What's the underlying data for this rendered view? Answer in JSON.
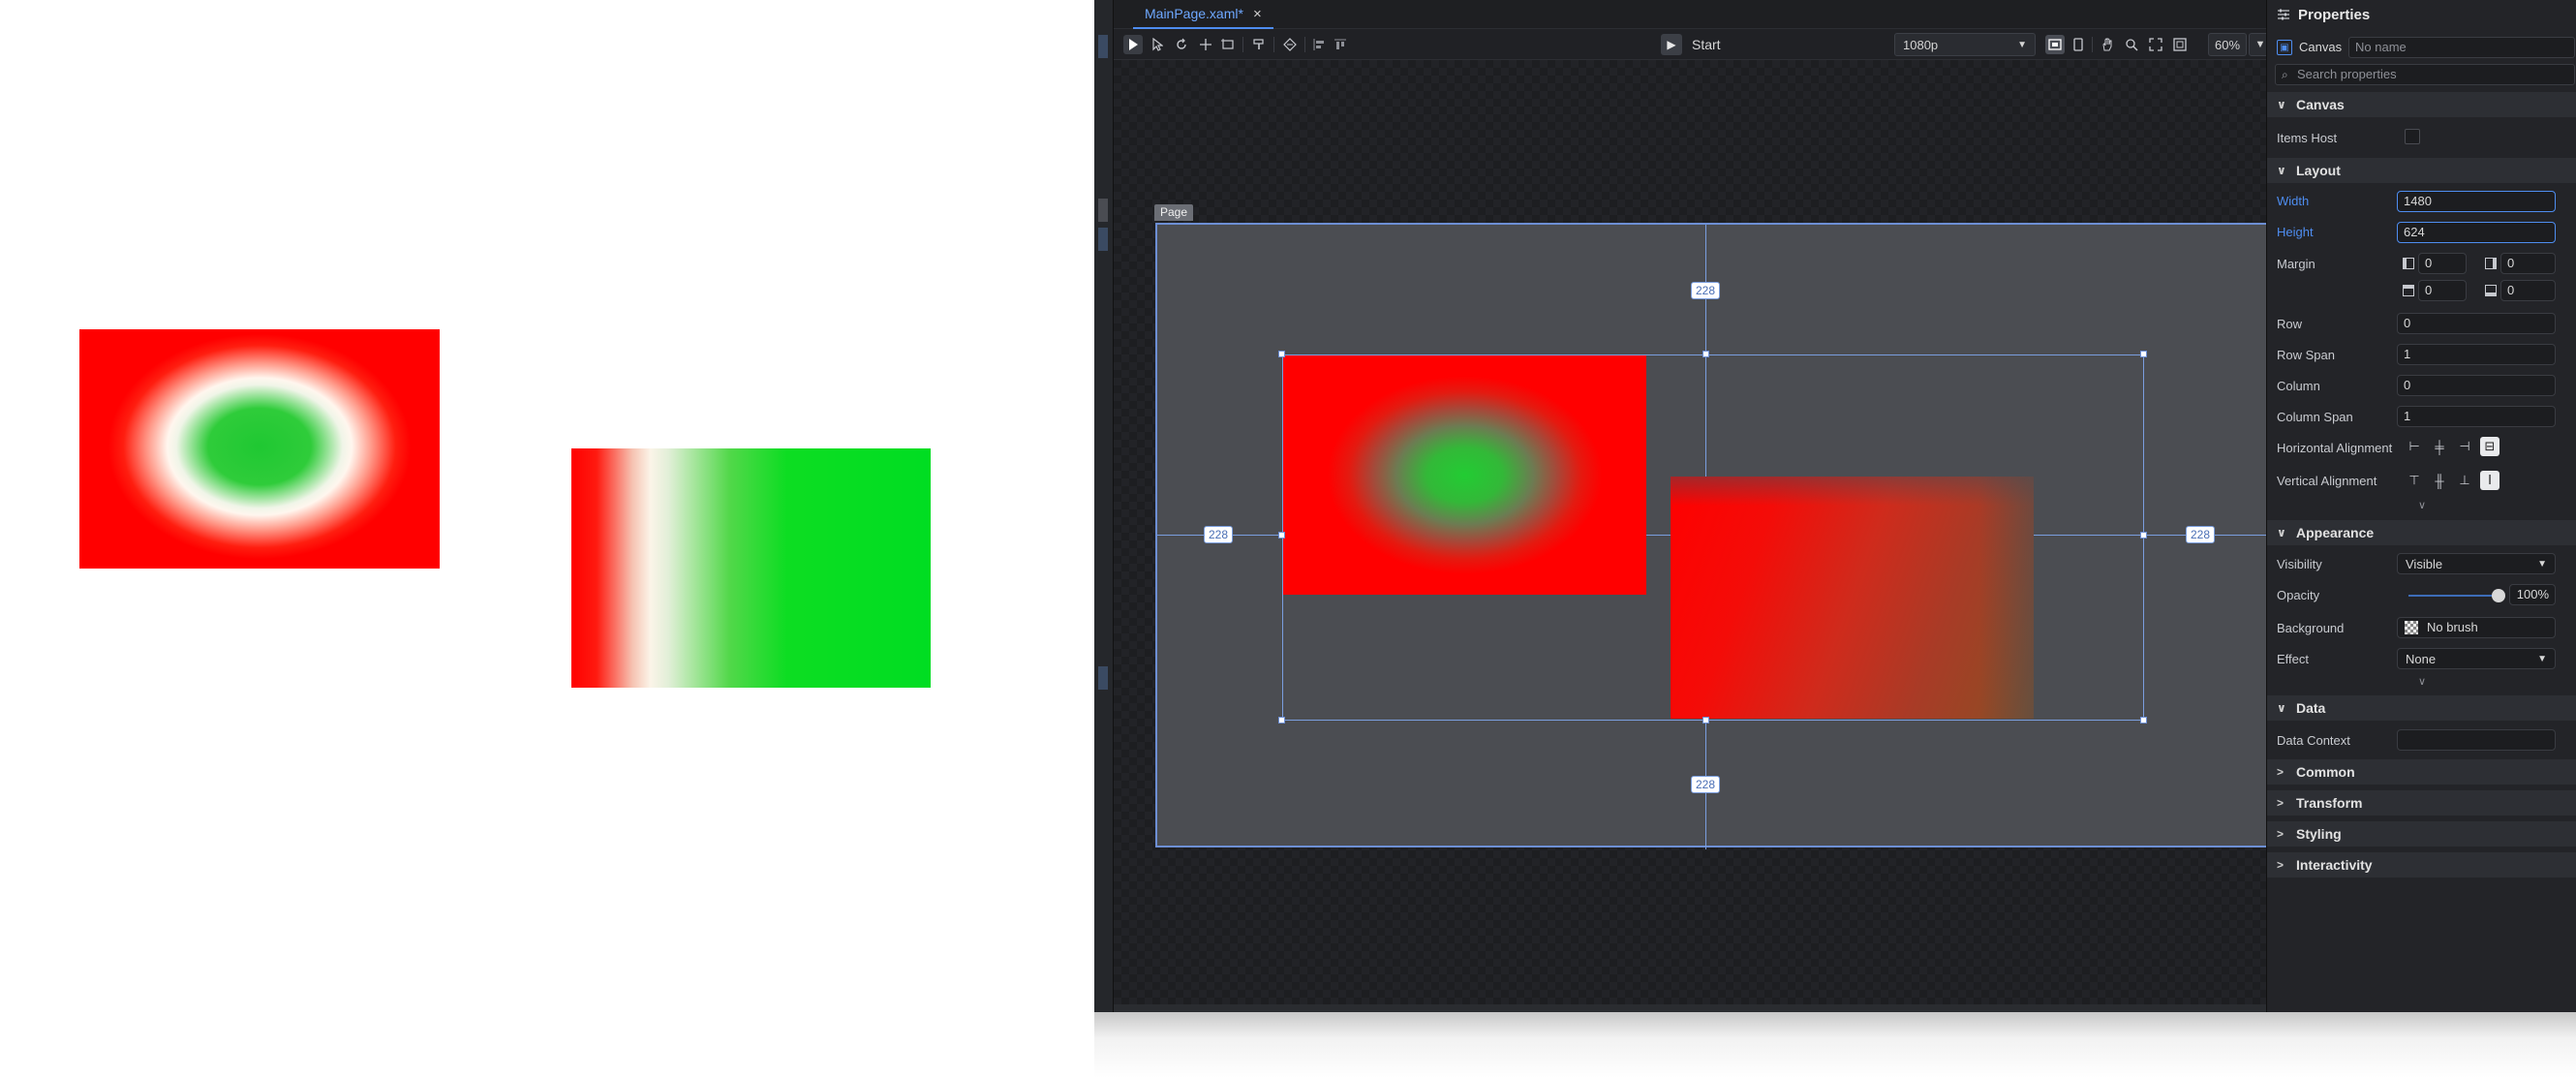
{
  "designer": {
    "tab": {
      "title": "MainPage.xaml*",
      "close_icon": "×"
    },
    "toolbar": {
      "start_label": "Start",
      "resolution": "1080p",
      "zoom": "60%"
    },
    "canvas": {
      "page_label": "Page",
      "guide_top": "228",
      "guide_bottom": "228",
      "guide_left": "228",
      "guide_right": "228"
    }
  },
  "properties": {
    "title": "Properties",
    "element_type": "Canvas",
    "name_placeholder": "No name",
    "search_placeholder": "Search properties",
    "sections": {
      "canvas": "Canvas",
      "layout": "Layout",
      "appearance": "Appearance",
      "data": "Data",
      "common": "Common",
      "transform": "Transform",
      "styling": "Styling",
      "interactivity": "Interactivity"
    },
    "canvas_props": {
      "items_host_label": "Items Host"
    },
    "layout": {
      "width_label": "Width",
      "width_value": "1480",
      "height_label": "Height",
      "height_value": "624",
      "margin_label": "Margin",
      "margin_left": "0",
      "margin_right": "0",
      "margin_top": "0",
      "margin_bottom": "0",
      "row_label": "Row",
      "row_value": "0",
      "row_span_label": "Row Span",
      "row_span_value": "1",
      "column_label": "Column",
      "column_value": "0",
      "column_span_label": "Column Span",
      "column_span_value": "1",
      "h_align_label": "Horizontal Alignment",
      "v_align_label": "Vertical Alignment"
    },
    "appearance": {
      "visibility_label": "Visibility",
      "visibility_value": "Visible",
      "opacity_label": "Opacity",
      "opacity_value": "100%",
      "opacity_level": 1.0,
      "background_label": "Background",
      "background_value": "No brush",
      "effect_label": "Effect",
      "effect_value": "None"
    },
    "data": {
      "data_context_label": "Data Context"
    }
  },
  "colors": {
    "accent": "#4e8df0",
    "red": "#ff0000",
    "green": "#00dd22"
  }
}
